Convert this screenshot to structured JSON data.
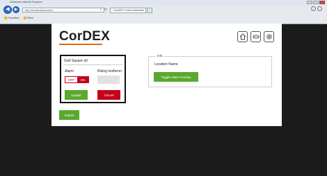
{
  "browser": {
    "window_title": "Windows Internet Explorer",
    "address": "http://localhost/cordex/",
    "tab_title": "CorDEX Control Monitor",
    "favorites": [
      "Favorites",
      "Sites"
    ]
  },
  "app": {
    "logo": "CorDEX",
    "accent_color": "#e06b00",
    "header_icons": [
      "home-icon",
      "alarm-icon",
      "gear-icon"
    ]
  },
  "grid_panel": {
    "title": "Grid Square a0",
    "alarm_label": "Alarm",
    "alarm_toggle": {
      "off_label": "OFF",
      "on_label": "ON",
      "state": "ON"
    },
    "rising_label": "Rising Isotherm",
    "rising_value": "",
    "update_label": "Update",
    "cancel_label": "Cancel"
  },
  "info_panel": {
    "legend": "Info",
    "location_label": "Location Name",
    "toggle_overlay_label": "Toggle Alarm Overlay"
  },
  "submit_label": "Submit",
  "colors": {
    "green": "#5aa82e",
    "red": "#c4001a",
    "background": "#1b1b1b"
  }
}
